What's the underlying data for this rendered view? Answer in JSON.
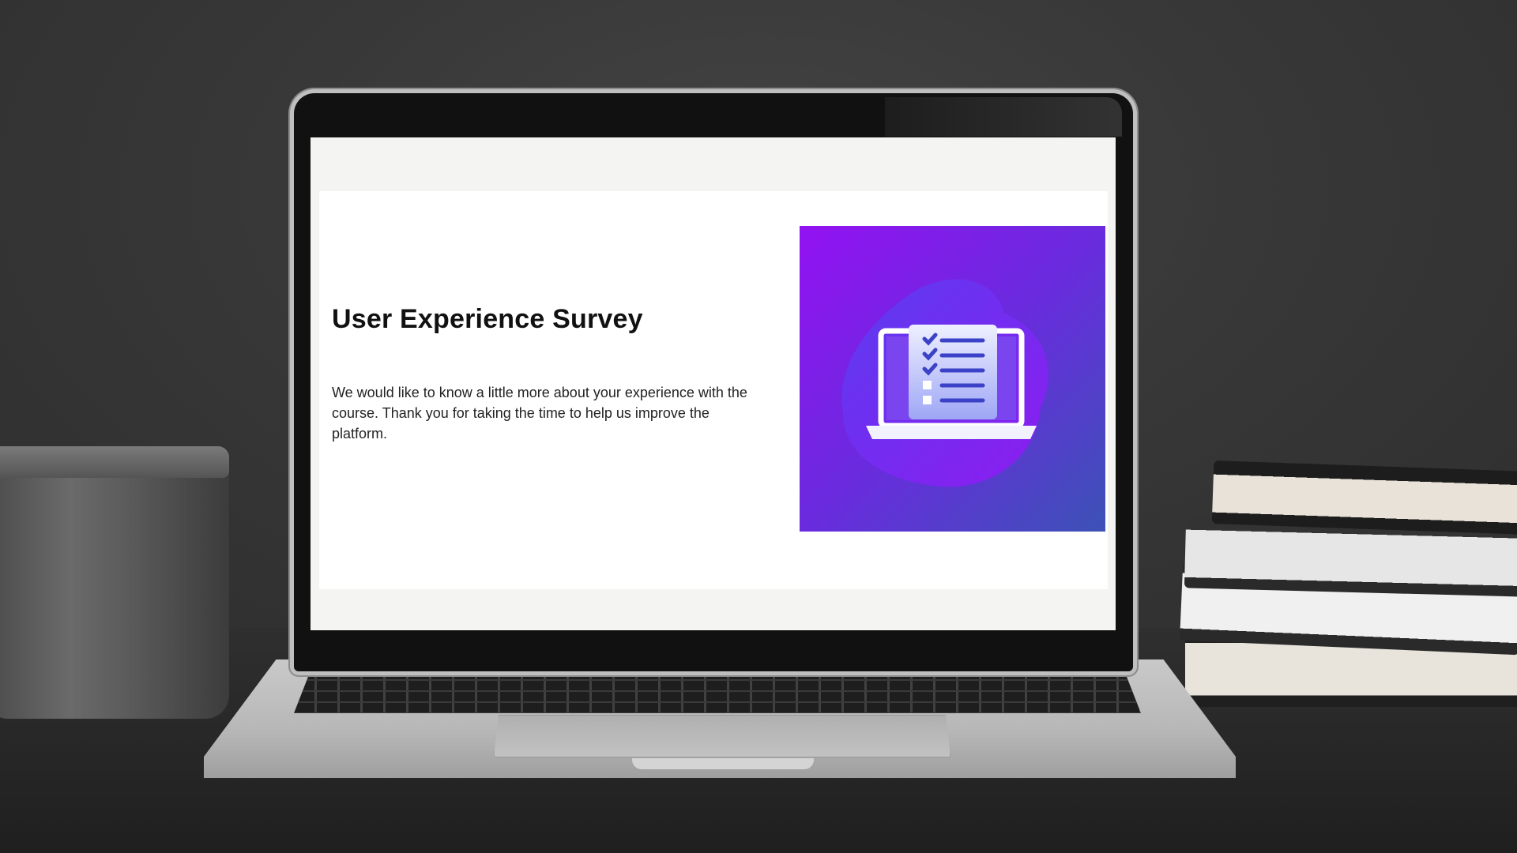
{
  "survey": {
    "title": "User Experience Survey",
    "description": "We would like to know a little more about your experience with the course. Thank you for taking the time to help us improve the platform."
  },
  "illustration": {
    "icon": "laptop-checklist-icon",
    "gradient": [
      "#9312f2",
      "#3c52b6"
    ]
  }
}
